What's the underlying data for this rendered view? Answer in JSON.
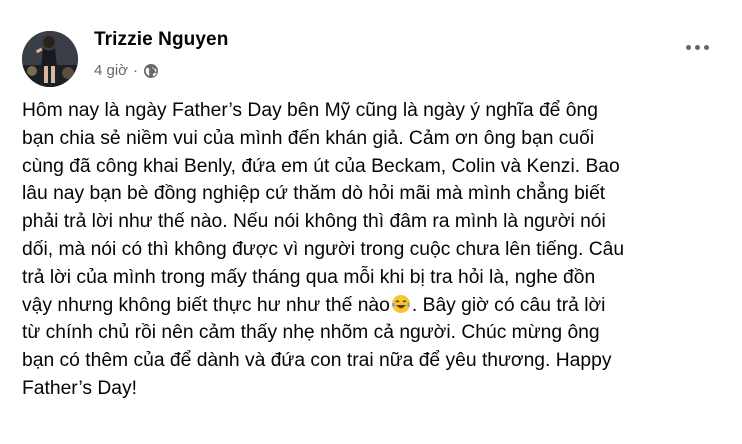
{
  "post": {
    "author": "Trizzie Nguyen",
    "time": "4 giờ",
    "separator": "·",
    "privacy_icon": "globe-icon",
    "menu_icon": "more-options-icon",
    "body_lines": [
      "Hôm nay là ngày Father’s Day bên Mỹ cũng là ngày ý nghĩa để ông",
      "bạn chia sẻ niềm vui của mình đến khán giả. Cảm ơn ông bạn cuối",
      "cùng đã công khai Benly, đứa em út của Beckam, Colin và Kenzi. Bao",
      "lâu nay bạn bè đồng nghiệp cứ thăm dò hỏi mãi mà mình chẳng biết",
      "phải trả lời như thế nào. Nếu nói không thì đâm ra mình là người nói",
      "dối, mà nói có thì không được vì người trong cuộc chưa lên tiếng. Câu",
      "trả lời của mình trong mấy tháng qua mỗi khi bị tra hỏi là, nghe đồn",
      "vậy nhưng không biết thực hư như thế nào",
      "từ chính chủ rồi nên cảm thấy nhẹ nhõm cả người. Chúc mừng ông",
      "bạn có thêm của để dành và đứa con trai nữa để yêu thương. Happy",
      "Father’s Day!"
    ],
    "line8_after_emoji": ". Bây giờ có câu trả lời",
    "emoji": "face-with-tears-of-joy"
  }
}
